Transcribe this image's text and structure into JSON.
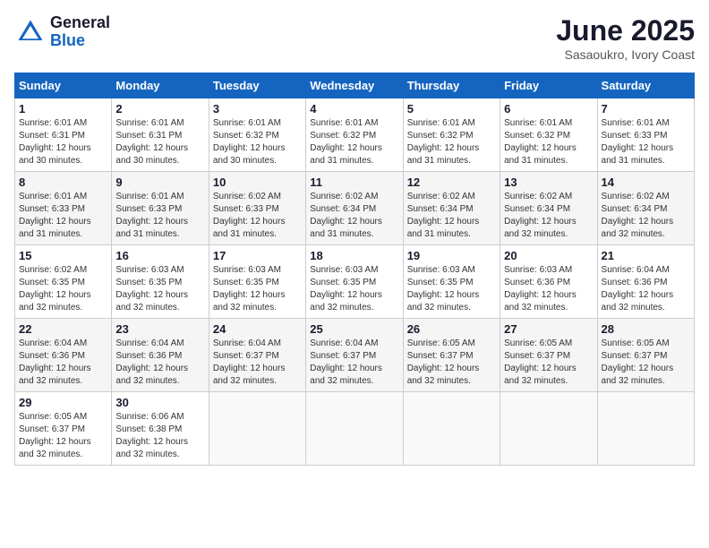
{
  "header": {
    "logo_general": "General",
    "logo_blue": "Blue",
    "title": "June 2025",
    "location": "Sasaoukro, Ivory Coast"
  },
  "weekdays": [
    "Sunday",
    "Monday",
    "Tuesday",
    "Wednesday",
    "Thursday",
    "Friday",
    "Saturday"
  ],
  "weeks": [
    [
      {
        "day": "1",
        "sunrise": "6:01 AM",
        "sunset": "6:31 PM",
        "daylight": "12 hours and 30 minutes."
      },
      {
        "day": "2",
        "sunrise": "6:01 AM",
        "sunset": "6:31 PM",
        "daylight": "12 hours and 30 minutes."
      },
      {
        "day": "3",
        "sunrise": "6:01 AM",
        "sunset": "6:32 PM",
        "daylight": "12 hours and 30 minutes."
      },
      {
        "day": "4",
        "sunrise": "6:01 AM",
        "sunset": "6:32 PM",
        "daylight": "12 hours and 31 minutes."
      },
      {
        "day": "5",
        "sunrise": "6:01 AM",
        "sunset": "6:32 PM",
        "daylight": "12 hours and 31 minutes."
      },
      {
        "day": "6",
        "sunrise": "6:01 AM",
        "sunset": "6:32 PM",
        "daylight": "12 hours and 31 minutes."
      },
      {
        "day": "7",
        "sunrise": "6:01 AM",
        "sunset": "6:33 PM",
        "daylight": "12 hours and 31 minutes."
      }
    ],
    [
      {
        "day": "8",
        "sunrise": "6:01 AM",
        "sunset": "6:33 PM",
        "daylight": "12 hours and 31 minutes."
      },
      {
        "day": "9",
        "sunrise": "6:01 AM",
        "sunset": "6:33 PM",
        "daylight": "12 hours and 31 minutes."
      },
      {
        "day": "10",
        "sunrise": "6:02 AM",
        "sunset": "6:33 PM",
        "daylight": "12 hours and 31 minutes."
      },
      {
        "day": "11",
        "sunrise": "6:02 AM",
        "sunset": "6:34 PM",
        "daylight": "12 hours and 31 minutes."
      },
      {
        "day": "12",
        "sunrise": "6:02 AM",
        "sunset": "6:34 PM",
        "daylight": "12 hours and 31 minutes."
      },
      {
        "day": "13",
        "sunrise": "6:02 AM",
        "sunset": "6:34 PM",
        "daylight": "12 hours and 32 minutes."
      },
      {
        "day": "14",
        "sunrise": "6:02 AM",
        "sunset": "6:34 PM",
        "daylight": "12 hours and 32 minutes."
      }
    ],
    [
      {
        "day": "15",
        "sunrise": "6:02 AM",
        "sunset": "6:35 PM",
        "daylight": "12 hours and 32 minutes."
      },
      {
        "day": "16",
        "sunrise": "6:03 AM",
        "sunset": "6:35 PM",
        "daylight": "12 hours and 32 minutes."
      },
      {
        "day": "17",
        "sunrise": "6:03 AM",
        "sunset": "6:35 PM",
        "daylight": "12 hours and 32 minutes."
      },
      {
        "day": "18",
        "sunrise": "6:03 AM",
        "sunset": "6:35 PM",
        "daylight": "12 hours and 32 minutes."
      },
      {
        "day": "19",
        "sunrise": "6:03 AM",
        "sunset": "6:35 PM",
        "daylight": "12 hours and 32 minutes."
      },
      {
        "day": "20",
        "sunrise": "6:03 AM",
        "sunset": "6:36 PM",
        "daylight": "12 hours and 32 minutes."
      },
      {
        "day": "21",
        "sunrise": "6:04 AM",
        "sunset": "6:36 PM",
        "daylight": "12 hours and 32 minutes."
      }
    ],
    [
      {
        "day": "22",
        "sunrise": "6:04 AM",
        "sunset": "6:36 PM",
        "daylight": "12 hours and 32 minutes."
      },
      {
        "day": "23",
        "sunrise": "6:04 AM",
        "sunset": "6:36 PM",
        "daylight": "12 hours and 32 minutes."
      },
      {
        "day": "24",
        "sunrise": "6:04 AM",
        "sunset": "6:37 PM",
        "daylight": "12 hours and 32 minutes."
      },
      {
        "day": "25",
        "sunrise": "6:04 AM",
        "sunset": "6:37 PM",
        "daylight": "12 hours and 32 minutes."
      },
      {
        "day": "26",
        "sunrise": "6:05 AM",
        "sunset": "6:37 PM",
        "daylight": "12 hours and 32 minutes."
      },
      {
        "day": "27",
        "sunrise": "6:05 AM",
        "sunset": "6:37 PM",
        "daylight": "12 hours and 32 minutes."
      },
      {
        "day": "28",
        "sunrise": "6:05 AM",
        "sunset": "6:37 PM",
        "daylight": "12 hours and 32 minutes."
      }
    ],
    [
      {
        "day": "29",
        "sunrise": "6:05 AM",
        "sunset": "6:37 PM",
        "daylight": "12 hours and 32 minutes."
      },
      {
        "day": "30",
        "sunrise": "6:06 AM",
        "sunset": "6:38 PM",
        "daylight": "12 hours and 32 minutes."
      },
      null,
      null,
      null,
      null,
      null
    ]
  ],
  "labels": {
    "sunrise": "Sunrise:",
    "sunset": "Sunset:",
    "daylight": "Daylight:"
  }
}
